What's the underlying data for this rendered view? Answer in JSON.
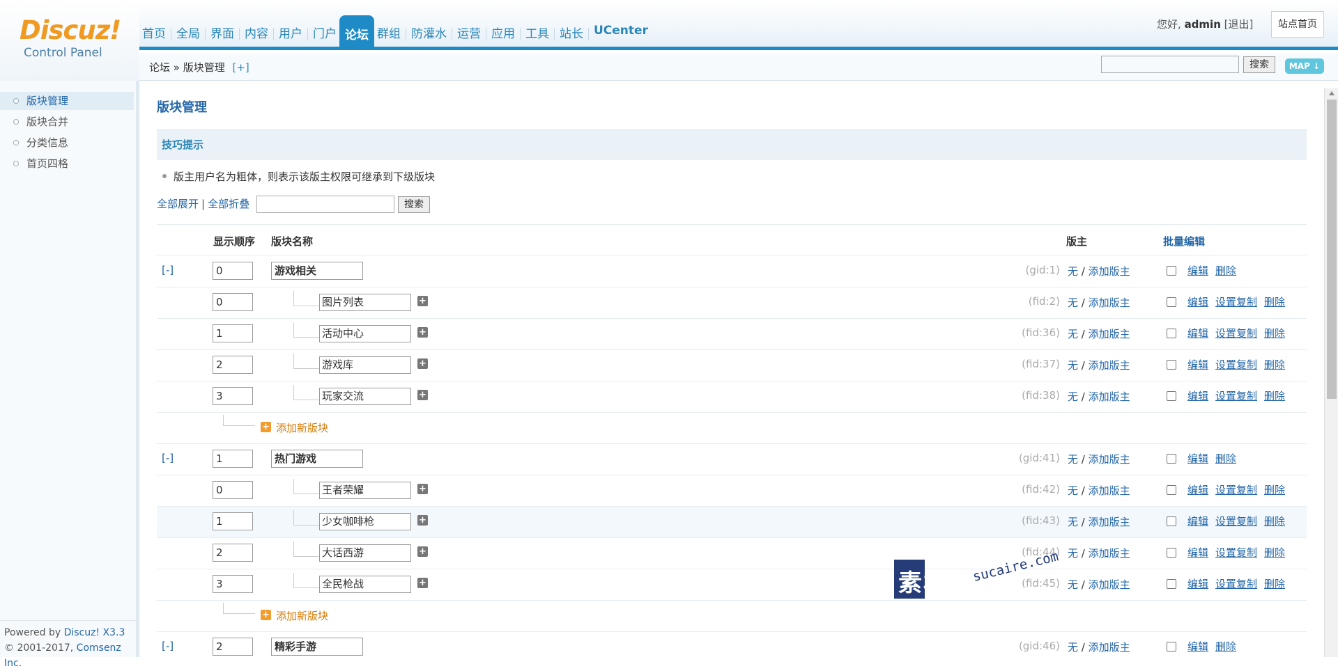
{
  "logo": {
    "brand": "Discuz!",
    "subtitle": "Control Panel"
  },
  "nav": [
    "首页",
    "全局",
    "界面",
    "内容",
    "用户",
    "门户",
    "论坛",
    "群组",
    "防灌水",
    "运营",
    "应用",
    "工具",
    "站长",
    "UCenter"
  ],
  "nav_active": "论坛",
  "user": {
    "greeting": "您好,",
    "name": "admin",
    "logout": "[退出]"
  },
  "site_home": "站点首页",
  "breadcrumb": {
    "text": "论坛 » 版块管理",
    "add": "[+]"
  },
  "top_search_button": "搜索",
  "map_button": "MAP ↓",
  "sidebar": {
    "items": [
      "版块管理",
      "版块合并",
      "分类信息",
      "首页四格"
    ],
    "active": 0,
    "powered": "Powered by ",
    "powered_product": "Discuz! X3.3",
    "copyright": "© 2001-2017, ",
    "copyright_company": "Comsenz Inc."
  },
  "page_title": "版块管理",
  "tips": {
    "title": "技巧提示",
    "text": "版主用户名为粗体，则表示该版主权限可继承到下级版块"
  },
  "tools": {
    "expand_all": "全部展开",
    "sep": "|",
    "collapse_all": "全部折叠",
    "search_button": "搜索"
  },
  "headers": {
    "order": "显示顺序",
    "name": "版块名称",
    "moderator": "版主",
    "batch_edit": "批量编辑"
  },
  "labels": {
    "toggle": "[-]",
    "none": "无",
    "slash": " / ",
    "add_mod": "添加版主",
    "edit": "编辑",
    "copy": "设置复制",
    "delete": "删除",
    "add_forum": "添加新版块"
  },
  "groups": [
    {
      "order": "0",
      "name": "游戏相关",
      "id": "(gid:1)",
      "forums": [
        {
          "order": "0",
          "name": "图片列表",
          "id": "(fid:2)"
        },
        {
          "order": "1",
          "name": "活动中心",
          "id": "(fid:36)"
        },
        {
          "order": "2",
          "name": "游戏库",
          "id": "(fid:37)"
        },
        {
          "order": "3",
          "name": "玩家交流",
          "id": "(fid:38)"
        }
      ]
    },
    {
      "order": "1",
      "name": "热门游戏",
      "id": "(gid:41)",
      "forums": [
        {
          "order": "0",
          "name": "王者荣耀",
          "id": "(fid:42)"
        },
        {
          "order": "1",
          "name": "少女咖啡枪",
          "id": "(fid:43)"
        },
        {
          "order": "2",
          "name": "大话西游",
          "id": "(fid:44)"
        },
        {
          "order": "3",
          "name": "全民枪战",
          "id": "(fid:45)"
        }
      ]
    },
    {
      "order": "2",
      "name": "精彩手游",
      "id": "(gid:46)",
      "forums": []
    }
  ],
  "watermark": {
    "cn": "素材熱",
    "en": "sucaire.com"
  }
}
